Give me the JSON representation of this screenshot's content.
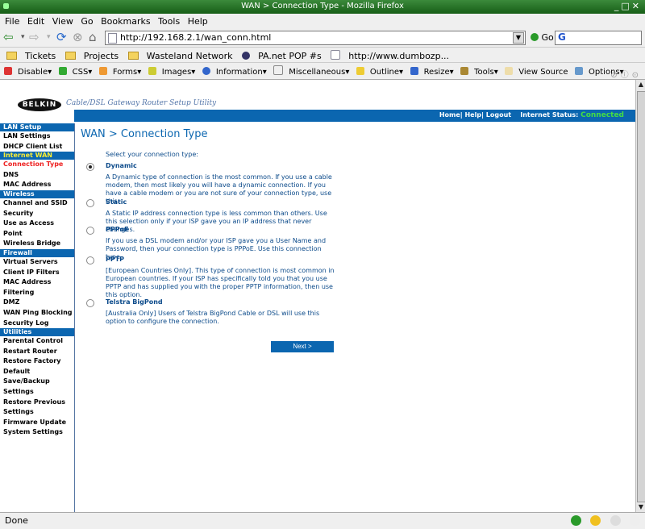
{
  "window": {
    "title": "WAN > Connection Type - Mozilla Firefox"
  },
  "menu": [
    "File",
    "Edit",
    "View",
    "Go",
    "Bookmarks",
    "Tools",
    "Help"
  ],
  "nav": {
    "url": "http://192.168.2.1/wan_conn.html",
    "go_label": "Go",
    "search_value": "G"
  },
  "bookmarks": [
    "Tickets",
    "Projects",
    "Wasteland Network",
    "PA.net POP #s",
    "http://www.dumbozp..."
  ],
  "devtools": [
    "Disable▾",
    "CSS▾",
    "Forms▾",
    "Images▾",
    "Information▾",
    "Miscellaneous▾",
    "Outline▾",
    "Resize▾",
    "Tools▾",
    "View Source",
    "Options▾"
  ],
  "header": {
    "logo": "BELKIN",
    "tagline": "Cable/DSL Gateway Router Setup Utility",
    "links": "Home| Help| Logout",
    "status_label": "Internet Status:",
    "status_value": "Connected"
  },
  "sidebar": [
    {
      "type": "head",
      "label": "LAN Setup"
    },
    {
      "type": "item",
      "label": "LAN Settings"
    },
    {
      "type": "item",
      "label": "DHCP Client List"
    },
    {
      "type": "head",
      "label": "Internet WAN",
      "highlight": true
    },
    {
      "type": "item",
      "label": "Connection Type",
      "active": true
    },
    {
      "type": "item",
      "label": "DNS"
    },
    {
      "type": "item",
      "label": "MAC Address"
    },
    {
      "type": "head",
      "label": "Wireless"
    },
    {
      "type": "item",
      "label": "Channel and SSID"
    },
    {
      "type": "item",
      "label": "Security"
    },
    {
      "type": "item",
      "label": "Use as Access Point"
    },
    {
      "type": "item",
      "label": "Wireless Bridge"
    },
    {
      "type": "head",
      "label": "Firewall"
    },
    {
      "type": "item",
      "label": "Virtual Servers"
    },
    {
      "type": "item",
      "label": "Client IP Filters"
    },
    {
      "type": "item",
      "label": "MAC Address Filtering"
    },
    {
      "type": "item",
      "label": "DMZ"
    },
    {
      "type": "item",
      "label": "WAN Ping Blocking"
    },
    {
      "type": "item",
      "label": "Security Log"
    },
    {
      "type": "head",
      "label": "Utilities"
    },
    {
      "type": "item",
      "label": "Parental Control"
    },
    {
      "type": "item",
      "label": "Restart Router"
    },
    {
      "type": "item",
      "label": "Restore Factory Default"
    },
    {
      "type": "item",
      "label": "Save/Backup Settings"
    },
    {
      "type": "item",
      "label": "Restore Previous Settings"
    },
    {
      "type": "item",
      "label": "Firmware Update"
    },
    {
      "type": "item",
      "label": "System Settings"
    }
  ],
  "page": {
    "title": "WAN > Connection Type",
    "prompt": "Select your connection type:",
    "options": [
      {
        "name": "Dynamic",
        "selected": true,
        "desc": "A Dynamic type of connection is the most common. If you use a cable modem, then most likely you will have a dynamic connection. If you have a cable modem or you are not sure of your connection type, use this."
      },
      {
        "name": "Static",
        "selected": false,
        "desc": "A Static IP address connection type is less common than others. Use this selection only if your ISP gave you an IP address that never changes."
      },
      {
        "name": "PPPoE",
        "selected": false,
        "desc": "If you use a DSL modem and/or your ISP gave you a User Name and Password, then your connection type is PPPoE. Use this connection type."
      },
      {
        "name": "PPTP",
        "selected": false,
        "desc": "[European Countries Only]. This type of connection is most common in European countries. If your ISP has specifically told you that you use PPTP and has supplied you with the proper PPTP information, then use this option."
      },
      {
        "name": "Telstra BigPond",
        "selected": false,
        "desc": "[Australia Only] Users of Telstra BigPond Cable or DSL will use this option to configure the connection."
      }
    ],
    "next_label": "Next >"
  },
  "status": {
    "text": "Done"
  },
  "colors": {
    "belkin_blue": "#0b66b0",
    "active_red": "#ee2222",
    "connected_green": "#44dd44",
    "section_yellow": "#ffee33"
  }
}
